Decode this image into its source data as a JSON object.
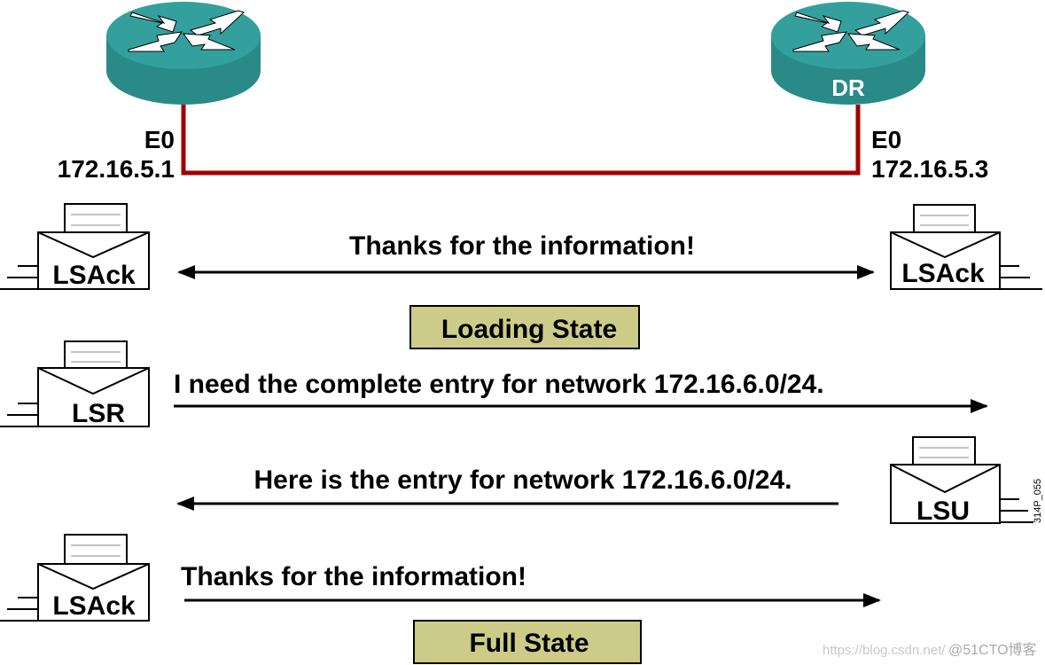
{
  "routers": {
    "left": {
      "label": "",
      "interface": "E0",
      "ip": "172.16.5.1"
    },
    "right": {
      "label": "DR",
      "interface": "E0",
      "ip": "172.16.5.3"
    }
  },
  "colors": {
    "router": "#2f9a97",
    "link": "#a00000",
    "state_box": "#cccc88"
  },
  "packets": {
    "lsack_left": "LSAck",
    "lsack_right": "LSAck",
    "lsr": "LSR",
    "lsu": "LSU",
    "lsack_bottom": "LSAck"
  },
  "messages": {
    "thanks_1": "Thanks for the information!",
    "request": "I need the complete entry for network 172.16.6.0/24.",
    "reply": "Here is the entry for network 172.16.6.0/24.",
    "thanks_2": "Thanks for the information!"
  },
  "states": {
    "loading": "Loading State",
    "full": "Full State"
  },
  "figure_id": "314P_055",
  "watermark": {
    "url": "https://blog.csdn.net/",
    "brand": "@51CTO博客"
  }
}
